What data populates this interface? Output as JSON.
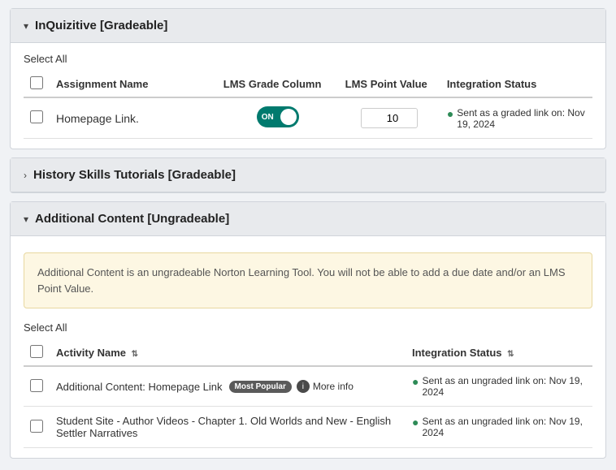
{
  "sections": [
    {
      "id": "inquizitive",
      "title": "InQuizitive [Gradeable]",
      "expanded": true,
      "type": "gradeable",
      "select_all_label": "Select All",
      "columns": [
        {
          "label": "",
          "type": "checkbox"
        },
        {
          "label": "Assignment Name"
        },
        {
          "label": "LMS Grade Column"
        },
        {
          "label": "LMS Point Value"
        },
        {
          "label": "Integration Status"
        }
      ],
      "rows": [
        {
          "assignment_name": "Homepage Link.",
          "toggle_on": true,
          "toggle_label": "ON",
          "point_value": "10",
          "status": "Sent as a graded link on: Nov 19, 2024"
        }
      ]
    },
    {
      "id": "history-skills",
      "title": "History Skills Tutorials [Gradeable]",
      "expanded": false,
      "type": "gradeable"
    },
    {
      "id": "additional-content",
      "title": "Additional Content [Ungradeable]",
      "expanded": true,
      "type": "ungradeable",
      "notice": "Additional Content is an ungradeable Norton Learning Tool. You will not be able to add a due date and/or an LMS Point Value.",
      "select_all_label": "Select All",
      "activity_columns": [
        {
          "label": "Activity Name",
          "sortable": true
        },
        {
          "label": "Integration Status",
          "sortable": true
        }
      ],
      "activity_rows": [
        {
          "name": "Additional Content: Homepage Link",
          "badge": "Most Popular",
          "has_more_info": true,
          "more_info_label": "More info",
          "status": "Sent as an ungraded link on: Nov 19, 2024"
        },
        {
          "name": "Student Site - Author Videos - Chapter 1. Old Worlds and New - English Settler Narratives",
          "badge": null,
          "has_more_info": false,
          "status": "Sent as an ungraded link on: Nov 19, 2024"
        }
      ]
    }
  ],
  "icons": {
    "chevron_down": "▾",
    "chevron_right": "›",
    "check_circle": "●",
    "sort": "⇅"
  }
}
